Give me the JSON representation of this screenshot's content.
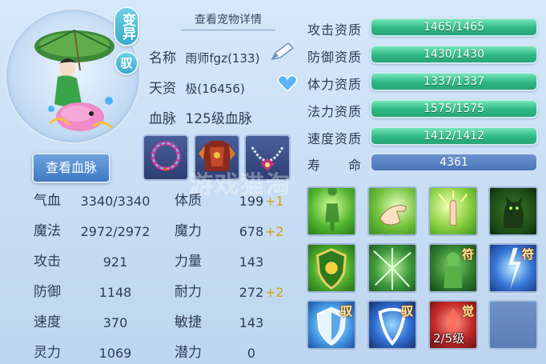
{
  "badges": {
    "variant": "变异",
    "tamed": "驭"
  },
  "header": {
    "view_pet_details": "查看宠物详情"
  },
  "info": {
    "name_label": "名称",
    "name_value": "雨师fgz(133)",
    "talent_label": "天资",
    "talent_value": "极(16456)",
    "bloodline_label": "血脉",
    "bloodline_value": "125级血脉"
  },
  "buttons": {
    "view_bloodline": "查看血脉"
  },
  "stats": [
    {
      "label": "气血",
      "value": "3340/3340"
    },
    {
      "label": "魔法",
      "value": "2972/2972"
    },
    {
      "label": "攻击",
      "value": "921"
    },
    {
      "label": "防御",
      "value": "1148"
    },
    {
      "label": "速度",
      "value": "370"
    },
    {
      "label": "灵力",
      "value": "1069"
    }
  ],
  "attributes": [
    {
      "label": "体质",
      "value": "199",
      "bonus": "+1"
    },
    {
      "label": "魔力",
      "value": "678",
      "bonus": "+2"
    },
    {
      "label": "力量",
      "value": "143",
      "bonus": ""
    },
    {
      "label": "耐力",
      "value": "272",
      "bonus": "+2"
    },
    {
      "label": "敏捷",
      "value": "143",
      "bonus": ""
    },
    {
      "label": "潜力",
      "value": "0",
      "bonus": ""
    }
  ],
  "aptitudes": [
    {
      "label": "攻击资质",
      "value": "1465/1465"
    },
    {
      "label": "防御资质",
      "value": "1430/1430"
    },
    {
      "label": "体力资质",
      "value": "1337/1337"
    },
    {
      "label": "法力资质",
      "value": "1575/1575"
    },
    {
      "label": "速度资质",
      "value": "1412/1412"
    }
  ],
  "life": {
    "label": "寿　　命",
    "value": "4361"
  },
  "skills": [
    {
      "name": "skill-silhouette-glow-icon",
      "tag": "",
      "level": ""
    },
    {
      "name": "skill-pointing-hand-icon",
      "tag": "",
      "level": ""
    },
    {
      "name": "skill-green-burst-icon",
      "tag": "",
      "level": ""
    },
    {
      "name": "skill-shadow-cat-icon",
      "tag": "",
      "level": ""
    },
    {
      "name": "skill-shield-emblem-icon",
      "tag": "",
      "level": ""
    },
    {
      "name": "skill-shatter-icon",
      "tag": "",
      "level": ""
    },
    {
      "name": "skill-figure-talisman-icon",
      "tag": "符",
      "level": ""
    },
    {
      "name": "skill-lightning-talisman-icon",
      "tag": "符",
      "level": ""
    },
    {
      "name": "skill-blue-shield-icon",
      "tag": "驭",
      "level": ""
    },
    {
      "name": "skill-crescent-icon",
      "tag": "驭",
      "level": ""
    },
    {
      "name": "skill-awaken-icon",
      "tag": "觉",
      "level": "2/5级"
    },
    {
      "name": "empty-slot",
      "tag": "",
      "level": ""
    }
  ],
  "watermark": "游戏猫淘"
}
